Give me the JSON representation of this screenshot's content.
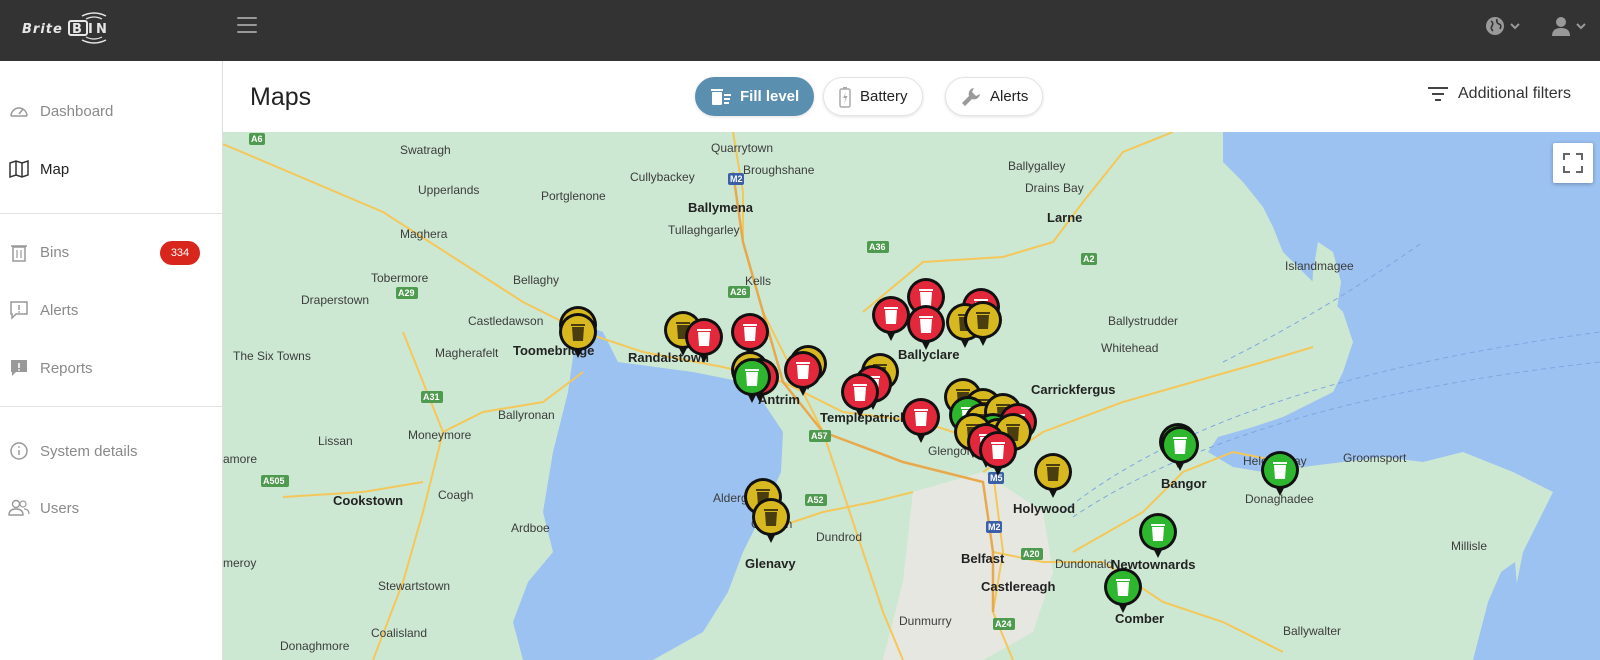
{
  "app": {
    "brand": "BriteBIN"
  },
  "sidebar": {
    "items": [
      {
        "label": "Dashboard",
        "icon": "speedometer-icon"
      },
      {
        "label": "Map",
        "icon": "map-icon"
      },
      {
        "label": "Bins",
        "icon": "trash-icon",
        "badge": "334"
      },
      {
        "label": "Alerts",
        "icon": "alert-message-icon"
      },
      {
        "label": "Reports",
        "icon": "report-icon"
      },
      {
        "label": "System details",
        "icon": "info-icon"
      },
      {
        "label": "Users",
        "icon": "users-icon"
      }
    ]
  },
  "header": {
    "title": "Maps",
    "toggles": [
      {
        "label": "Fill level",
        "icon": "fill-level-icon",
        "active": true
      },
      {
        "label": "Battery",
        "icon": "battery-icon",
        "active": false
      },
      {
        "label": "Alerts",
        "icon": "wrench-icon",
        "active": false
      }
    ],
    "filters_label": "Additional filters"
  },
  "colors": {
    "topbar": "#333333",
    "accent": "#5b8fb0",
    "badge": "#d9261c",
    "pin_red": "#e3283b",
    "pin_yellow": "#d8b81f",
    "pin_green": "#2fb62f",
    "land": "#cde8d2",
    "water": "#9cc2f2"
  },
  "map": {
    "places": [
      "Swatragh",
      "Quarrytown",
      "Cullybackey",
      "Broughshane",
      "Ballygalley",
      "Drains Bay",
      "Upperlands",
      "Portglenone",
      "Ballymena",
      "Tullaghgarley",
      "Larne",
      "Maghera",
      "Tobermore",
      "Bellaghy",
      "Kells",
      "Islandmagee",
      "Draperstown",
      "Castledawson",
      "Toomebridge",
      "Randalstown",
      "Ballyclare",
      "Ballystrudder",
      "Whitehead",
      "The Six Towns",
      "Magherafelt",
      "Antrim",
      "Templepatrick",
      "Carrickfergus",
      "Ballyronan",
      "Lissan",
      "Moneymore",
      "Glengormley",
      "Helen's Bay",
      "Groomsport",
      "Bangor",
      "Donaghadee",
      "amore",
      "Cookstown",
      "Coagh",
      "Aldergrove",
      "Crumlin",
      "Holywood",
      "Ardboe",
      "Dundrod",
      "Belfast",
      "Dundonald",
      "Newtownards",
      "Millisle",
      "meroy",
      "Stewartstown",
      "Glenavy",
      "Castlereagh",
      "Comber",
      "Coalisland",
      "Dunmurry",
      "Ballywalter",
      "Donaghmore"
    ],
    "roads": [
      "A6",
      "M2",
      "A36",
      "A26",
      "A29",
      "A2",
      "A31",
      "A505",
      "A57",
      "A52",
      "M5",
      "A20",
      "A24",
      "M2"
    ]
  }
}
